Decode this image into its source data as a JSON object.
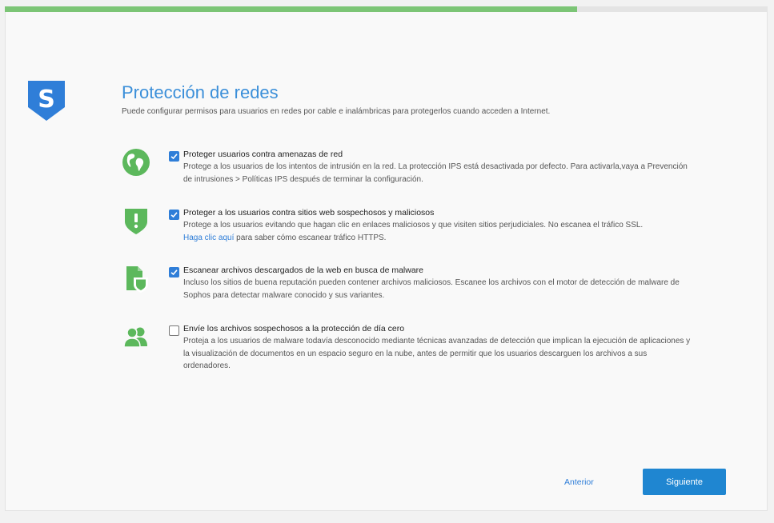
{
  "progress": {
    "percent": 75
  },
  "brand": {
    "logo_icon": "sophos-shield-logo",
    "accent": "#3b8fd9"
  },
  "page": {
    "title": "Protección de redes",
    "subtitle": "Puede configurar permisos para usuarios en redes por cable e inalámbricas para protegerlos cuando acceden a Internet."
  },
  "options": [
    {
      "icon": "globe-icon",
      "checked": true,
      "label": "Proteger usuarios contra amenazas de red",
      "description": "Protege a los usuarios de los intentos de intrusión en la red. La protección IPS está desactivada por defecto. Para activarla,vaya a Prevención de intrusiones > Políticas IPS después de terminar la configuración."
    },
    {
      "icon": "shield-warning-icon",
      "checked": true,
      "label": "Proteger a los usuarios contra sitios web sospechosos y maliciosos",
      "description": "Protege a los usuarios evitando que hagan clic en enlaces maliciosos y que visiten sitios perjudiciales. No escanea el tráfico SSL.",
      "link_text": "Haga clic aquí",
      "link_suffix": " para saber cómo escanear tráfico HTTPS."
    },
    {
      "icon": "file-shield-icon",
      "checked": true,
      "label": "Escanear archivos descargados de la web en busca de malware",
      "description": "Incluso los sitios de buena reputación pueden contener archivos maliciosos. Escanee los archivos con el motor de detección de malware de Sophos para detectar malware conocido y sus variantes."
    },
    {
      "icon": "users-icon",
      "checked": false,
      "label": "Envíe los archivos sospechosos a la protección de día cero",
      "description": "Proteja a los usuarios de malware todavía desconocido mediante técnicas avanzadas de detección que implican la ejecución de aplicaciones y la visualización de documentos en un espacio seguro en la nube, antes de permitir que los usuarios descarguen los archivos a sus ordenadores."
    }
  ],
  "buttons": {
    "previous": "Anterior",
    "next": "Siguiente"
  }
}
